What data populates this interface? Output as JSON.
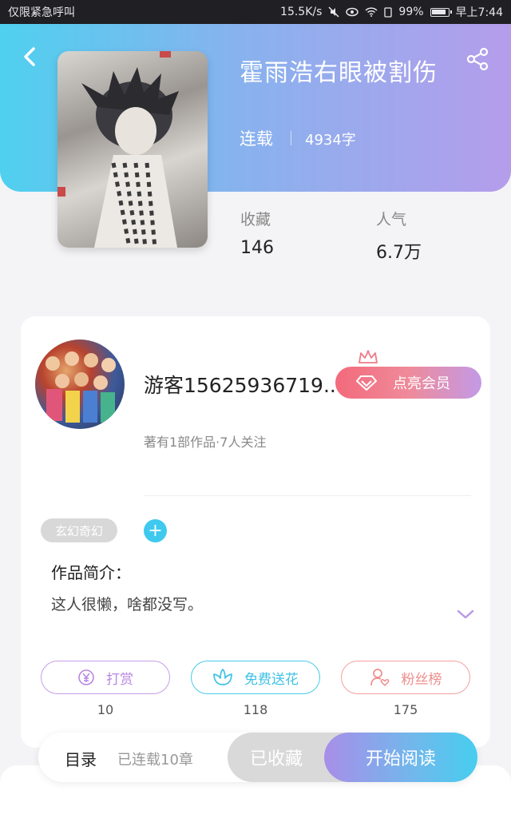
{
  "status_bar": {
    "left_text": "仅限紧急呼叫",
    "speed": "15.5K/s",
    "battery": "99%",
    "time": "早上7:44"
  },
  "book": {
    "title": "霍雨浩右眼被割伤",
    "status": "连载",
    "word_count": "4934字"
  },
  "stats": {
    "favorites_label": "收藏",
    "favorites_value": "146",
    "popularity_label": "人气",
    "popularity_value": "6.7万"
  },
  "author": {
    "name": "游客15625936719..",
    "meta": "著有1部作品·7人关注",
    "vip_label": "点亮会员"
  },
  "tags": {
    "genre": "玄幻奇幻",
    "add": "+"
  },
  "intro": {
    "heading": "作品简介：",
    "text": "这人很懒，啥都没写。"
  },
  "actions": [
    {
      "label": "打赏",
      "count": "10"
    },
    {
      "label": "免费送花",
      "count": "118"
    },
    {
      "label": "粉丝榜",
      "count": "175"
    }
  ],
  "bottom": {
    "toc_label": "目录",
    "chapters": "已连载10章",
    "collected_label": "已收藏",
    "read_label": "开始阅读"
  },
  "colors": {
    "accent_blue": "#47cdef",
    "accent_purple": "#b59deb",
    "accent_pink": "#f36a7b"
  }
}
